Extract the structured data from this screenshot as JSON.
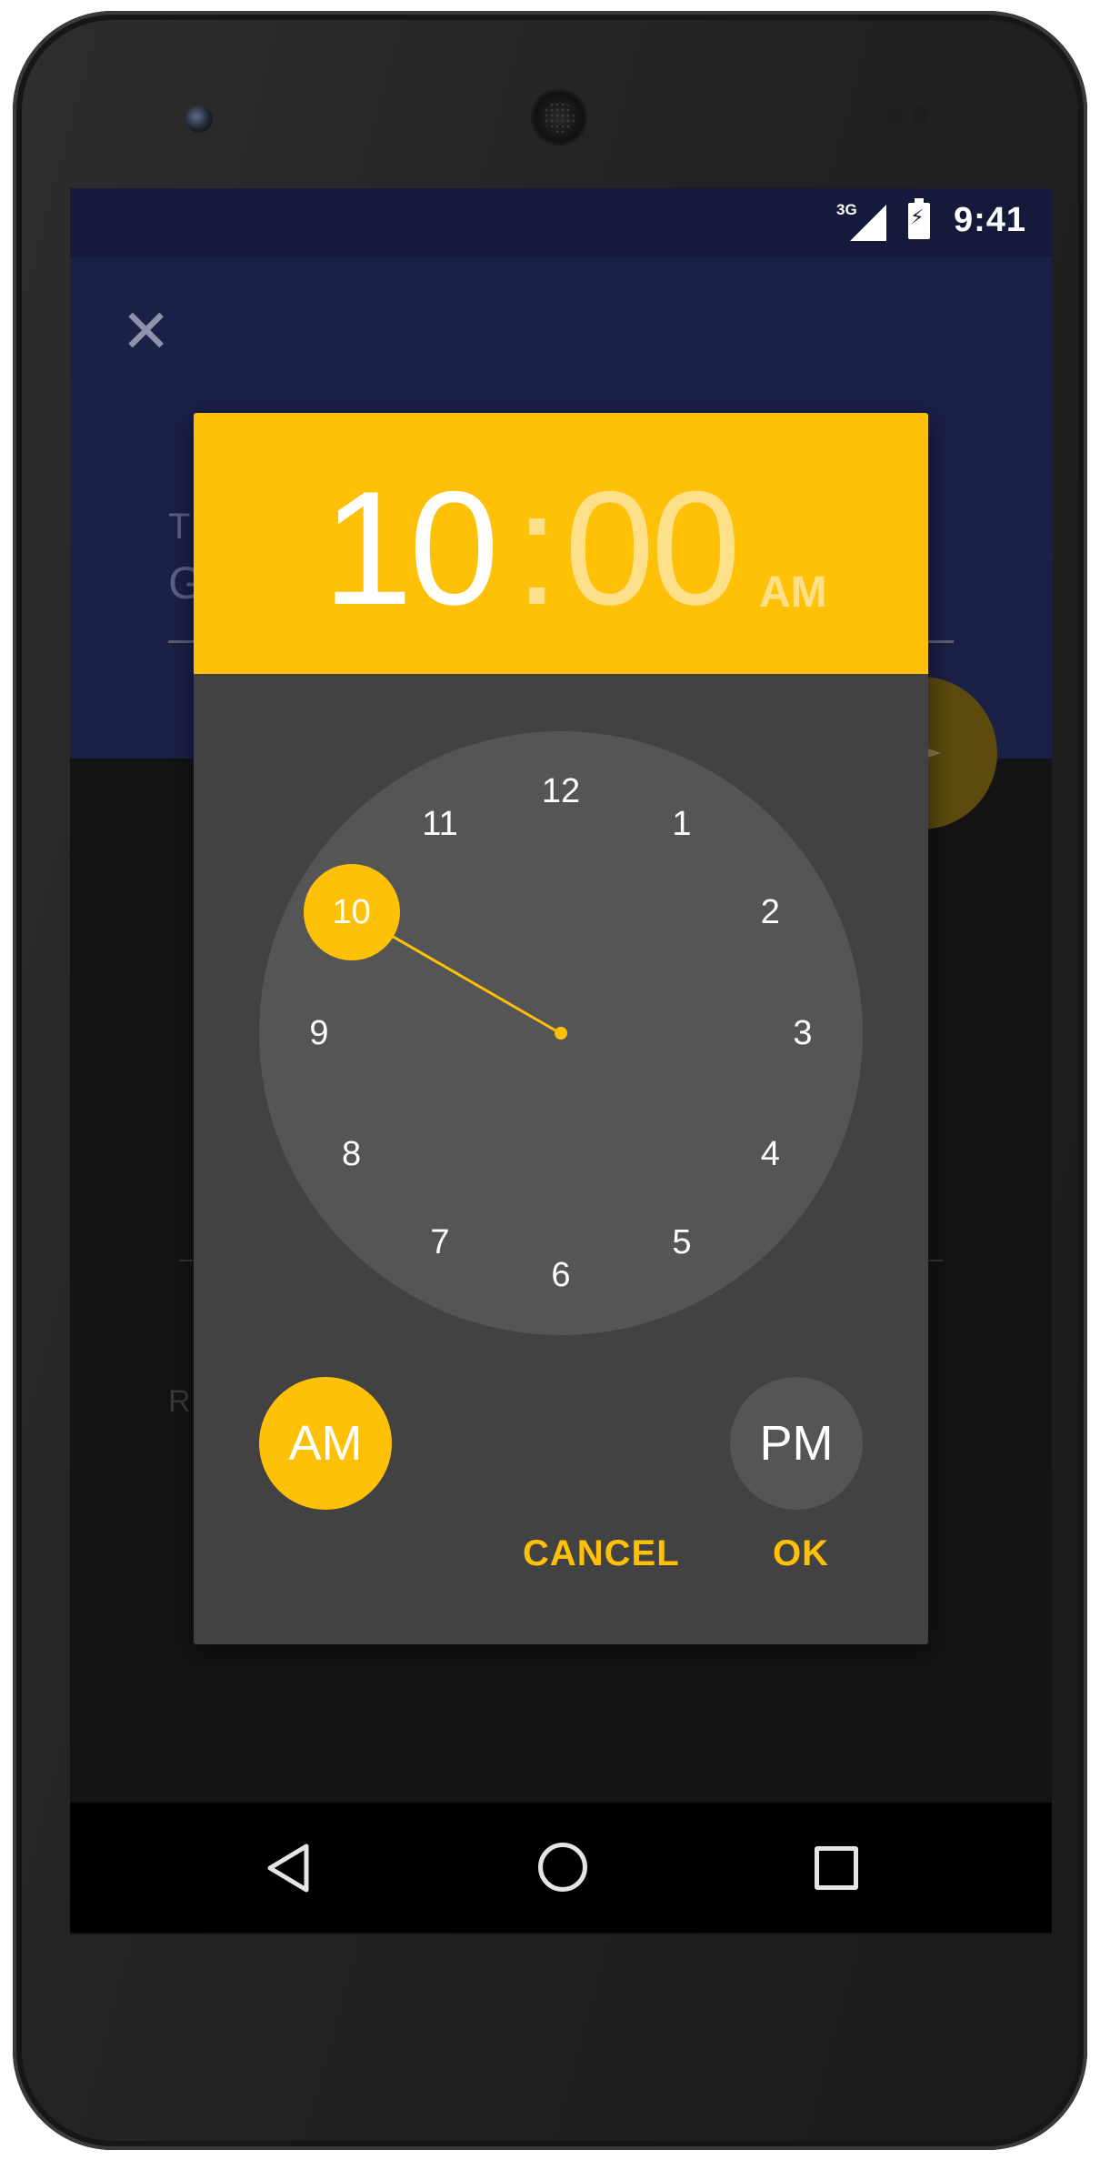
{
  "statusbar": {
    "network": "3G",
    "time": "9:41"
  },
  "background_app": {
    "field_label_partial": "T",
    "field_value_partial": "G",
    "row_label_partial": "R"
  },
  "time_picker": {
    "hour": "10",
    "separator": ":",
    "minute": "00",
    "period": "AM",
    "selected_hour": 10,
    "clock_numbers": [
      "12",
      "1",
      "2",
      "3",
      "4",
      "5",
      "6",
      "7",
      "8",
      "9",
      "10",
      "11"
    ],
    "am_label": "AM",
    "pm_label": "PM",
    "selected_period": "AM",
    "cancel_label": "CANCEL",
    "ok_label": "OK"
  },
  "colors": {
    "accent": "#ffc107",
    "dialog_bg": "#424242",
    "clock_face": "#555555",
    "app_header": "#1b2047"
  },
  "navigation": {
    "icons": [
      "back-icon",
      "home-icon",
      "recent-apps-icon"
    ]
  }
}
